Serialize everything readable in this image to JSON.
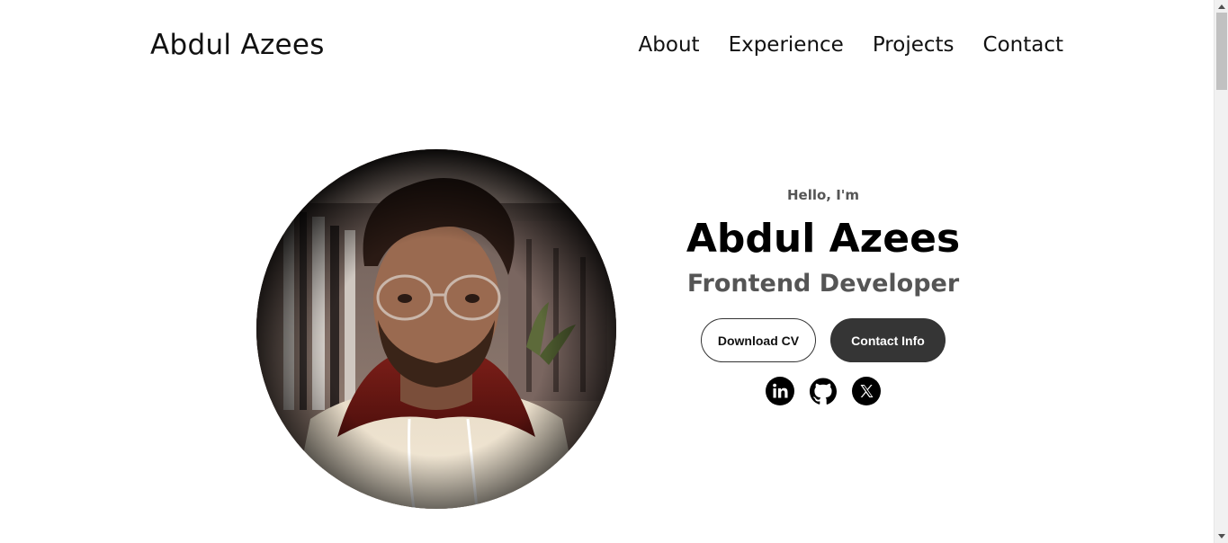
{
  "nav": {
    "logo": "Abdul Azees",
    "links": [
      "About",
      "Experience",
      "Projects",
      "Contact"
    ]
  },
  "hero": {
    "greeting": "Hello, I'm",
    "name": "Abdul Azees",
    "role": "Frontend Developer",
    "buttons": {
      "download_cv": "Download CV",
      "contact_info": "Contact Info"
    },
    "socials": [
      "linkedin-icon",
      "github-icon",
      "x-twitter-icon"
    ]
  },
  "colors": {
    "text": "#000000",
    "muted": "#555555",
    "button_dark": "#353535",
    "background": "#ffffff"
  }
}
